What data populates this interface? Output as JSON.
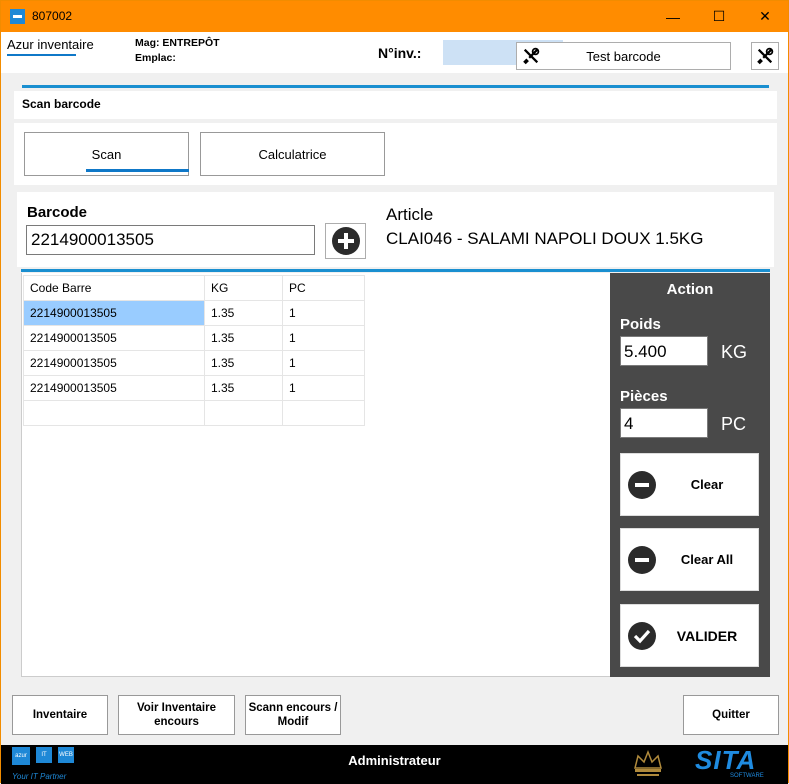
{
  "window": {
    "title": "807002",
    "minimize_symbol": "—",
    "maximize_symbol": "☐",
    "close_symbol": "✕"
  },
  "header": {
    "app_name": "Azur inventaire",
    "mag": "Mag: ENTREPÔT",
    "emplac": "Emplac:",
    "ninv_label": "N°inv.:",
    "ninv_value": "",
    "test_barcode_label": "Test barcode",
    "tools_icon": "tools-icon"
  },
  "section": {
    "title": "Scan barcode"
  },
  "tabs": [
    {
      "label": "Scan",
      "active": true
    },
    {
      "label": "Calculatrice",
      "active": false
    }
  ],
  "scan": {
    "barcode_label": "Barcode",
    "barcode_value": "2214900013505",
    "add_icon": "plus-circle-icon",
    "article_label": "Article",
    "article_value": "CLAI046 - SALAMI NAPOLI DOUX 1.5KG"
  },
  "grid": {
    "columns": [
      "Code Barre",
      "KG",
      "PC"
    ],
    "rows": [
      [
        "2214900013505",
        "1.35",
        "1"
      ],
      [
        "2214900013505",
        "1.35",
        "1"
      ],
      [
        "2214900013505",
        "1.35",
        "1"
      ],
      [
        "2214900013505",
        "1.35",
        "1"
      ],
      [
        "",
        "",
        ""
      ]
    ]
  },
  "action": {
    "title": "Action",
    "poids_label": "Poids",
    "poids_value": "5.400",
    "poids_unit": "KG",
    "pieces_label": "Pièces",
    "pieces_value": "4",
    "pieces_unit": "PC",
    "clear_label": "Clear",
    "clear_all_label": "Clear All",
    "valider_label": "VALIDER"
  },
  "bottom": {
    "inventaire": "Inventaire",
    "voir_line1": "Voir Inventaire",
    "voir_line2": "encours",
    "scann_line1": "Scann encours /",
    "scann_line2": "Modif",
    "quitter": "Quitter"
  },
  "footer": {
    "user": "Administrateur",
    "logo_blocks": [
      "azur",
      "IT",
      "WEB"
    ],
    "tagline": "Your IT Partner",
    "brand": "SITA",
    "brand_sub": "SOFTWARE"
  },
  "colors": {
    "titlebar": "#ff8c00",
    "accent": "#1a8fd0",
    "action_panel": "#494949",
    "selection": "#99ccff"
  }
}
